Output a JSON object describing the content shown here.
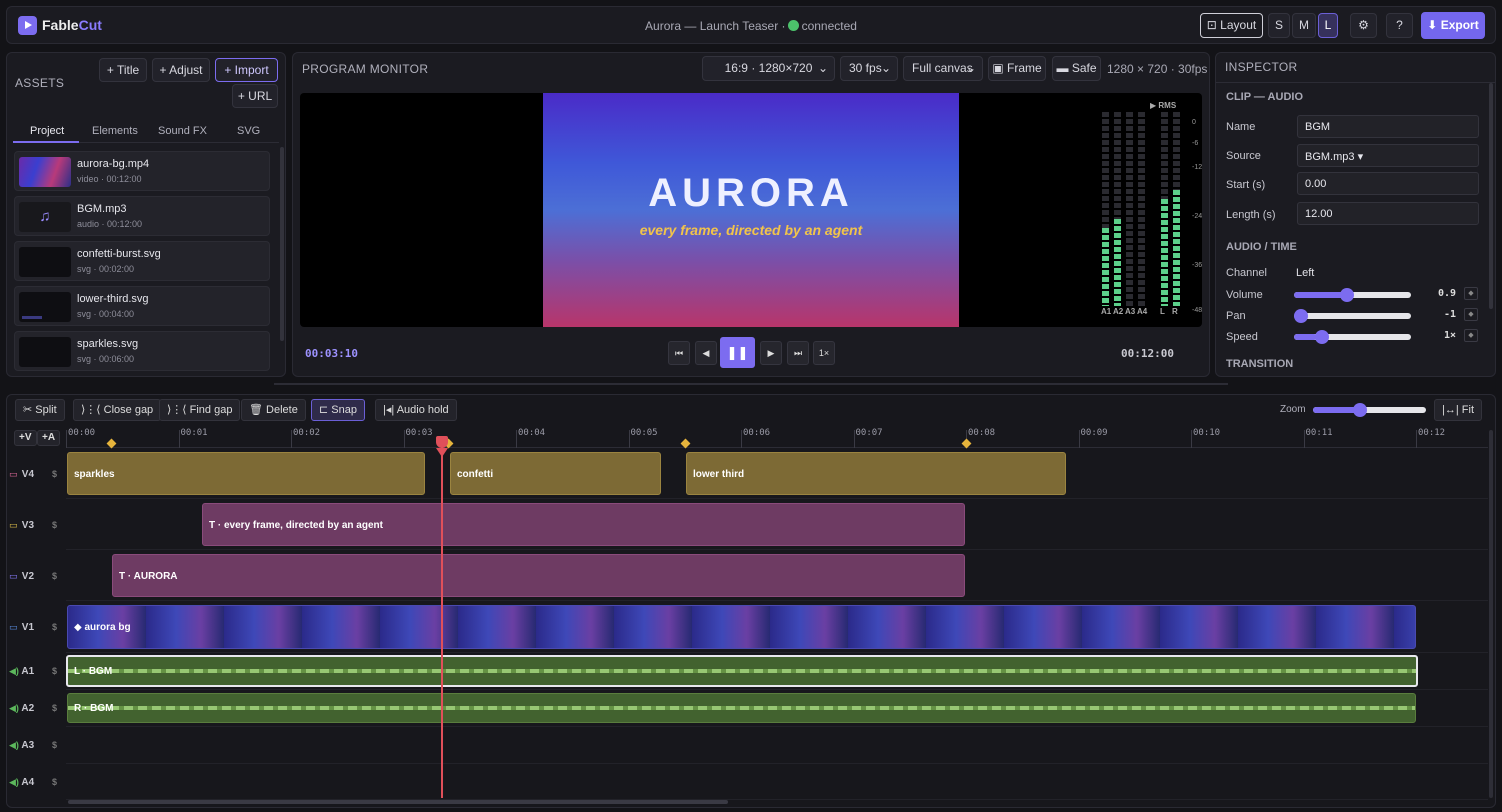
{
  "app": {
    "name_a": "Fable",
    "name_b": "Cut",
    "project": "Aurora — Launch Teaser ·",
    "status": "connected"
  },
  "topbar": {
    "layout": "Layout",
    "sizes": [
      "S",
      "M",
      "L"
    ],
    "selected_size": "L",
    "help": "?",
    "export": "Export"
  },
  "assets": {
    "title": "ASSETS",
    "buttons": [
      "+ Title",
      "+ Adjust",
      "+ Import",
      "+ URL"
    ],
    "tabs": [
      "Project",
      "Elements",
      "Sound FX",
      "SVG"
    ],
    "active_tab": "Project",
    "items": [
      {
        "name": "aurora-bg.mp4",
        "meta": "video · 00:12:00"
      },
      {
        "name": "BGM.mp3",
        "meta": "audio · 00:12:00"
      },
      {
        "name": "confetti-burst.svg",
        "meta": "svg · 00:02:00"
      },
      {
        "name": "lower-third.svg",
        "meta": "svg · 00:04:00"
      },
      {
        "name": "sparkles.svg",
        "meta": "svg · 00:06:00"
      }
    ]
  },
  "monitor": {
    "title": "PROGRAM MONITOR",
    "aspect": "16:9 · 1280×720",
    "fps": "30 fps",
    "canvas": "Full canvas",
    "frame": "Frame",
    "safe": "Safe",
    "info": "1280 × 720 · 30fps",
    "headline": "AURORA",
    "subtitle": "every frame, directed by an agent",
    "current_time": "00:03:10",
    "duration": "00:12:00",
    "speed": "1×",
    "meters": {
      "title": "▶ RMS",
      "labels": [
        "A1",
        "A2",
        "A3",
        "A4",
        "L",
        "R"
      ],
      "levels": [
        0.4,
        0.45,
        0,
        0,
        0.55,
        0.6
      ],
      "scale": [
        "0",
        "-6",
        "-12",
        "-24",
        "-36",
        "-48"
      ]
    }
  },
  "inspector": {
    "title": "INSPECTOR",
    "section1": "CLIP — AUDIO",
    "fields": [
      {
        "label": "Name",
        "value": "BGM"
      },
      {
        "label": "Source",
        "value": "BGM.mp3 ▾"
      },
      {
        "label": "Start (s)",
        "value": "0.00"
      },
      {
        "label": "Length (s)",
        "value": "12.00"
      }
    ],
    "section2": "AUDIO / TIME",
    "channel_label": "Channel",
    "channel_value": "Left",
    "sliders": [
      {
        "label": "Volume",
        "value": "0.9",
        "pos": 0.45
      },
      {
        "label": "Pan",
        "value": "-1",
        "pos": 0.0
      },
      {
        "label": "Speed",
        "value": "1×",
        "pos": 0.2
      }
    ],
    "section3": "TRANSITION"
  },
  "timeline": {
    "tools": [
      "Split",
      "Close gap",
      "Find gap",
      "Delete",
      "Snap",
      "Audio hold"
    ],
    "zoom_label": "Zoom",
    "zoom": 0.4,
    "fit": "Fit",
    "add_video": "+V",
    "add_audio": "+A",
    "ticks": [
      "00:00",
      "00:01",
      "00:02",
      "00:03",
      "00:04",
      "00:05",
      "00:06",
      "00:07",
      "00:08",
      "00:09",
      "00:10",
      "00:11",
      "00:12"
    ],
    "tracks": [
      "V4",
      "V3",
      "V2",
      "V1",
      "A1",
      "A2",
      "A3",
      "A4"
    ],
    "clips": {
      "sparkles": "sparkles",
      "confetti": "confetti",
      "lower": "lower third",
      "v3": "T · every frame, directed by an agent",
      "v2": "T · AURORA",
      "v1": "aurora bg",
      "a1": "L · BGM",
      "a2": "R · BGM"
    },
    "playhead_seconds": 3.33,
    "colors": {
      "accent": "#7c6cf0",
      "video_clip": "#7d6a35",
      "text_clip": "#6e3b63",
      "audio_clip": "#42622f",
      "playhead": "#e0505a"
    }
  }
}
